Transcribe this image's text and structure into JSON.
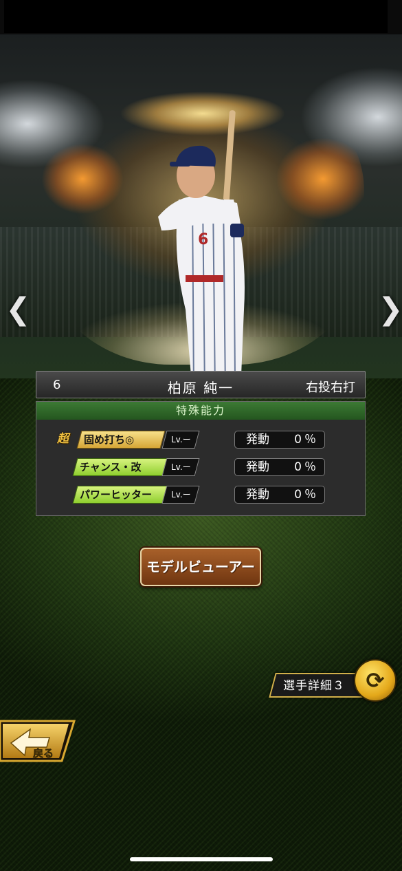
{
  "player": {
    "number": "6",
    "name": "柏原 純一",
    "handedness": "右投右打",
    "uniform_number": "6"
  },
  "nav": {
    "prev_icon": "chevron-left",
    "next_icon": "chevron-right",
    "prev_glyph": "❮",
    "next_glyph": "❯"
  },
  "abilities": {
    "header": "特殊能力",
    "super_mark": "超",
    "items": [
      {
        "name": "固め打ち◎",
        "level": "Lv.ー",
        "activation_label": "発動",
        "activation_value": "0％",
        "style": "gold"
      },
      {
        "name": "チャンス・改",
        "level": "Lv.ー",
        "activation_label": "発動",
        "activation_value": "0％",
        "style": "green"
      },
      {
        "name": "パワーヒッター",
        "level": "Lv.ー",
        "activation_label": "発動",
        "activation_value": "0％",
        "style": "green"
      }
    ]
  },
  "buttons": {
    "model_viewer": "モデルビューアー",
    "player_detail": "選手詳細３",
    "back": "戻る"
  },
  "colors": {
    "header_green": "#2f6a2a",
    "gold": "#d6a636",
    "button_brown": "#8a4a1c"
  }
}
